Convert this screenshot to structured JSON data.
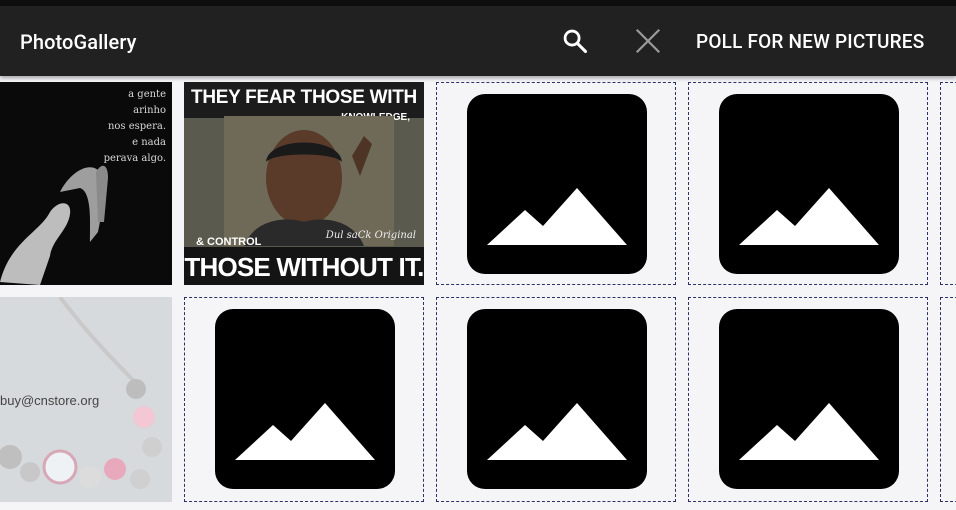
{
  "app": {
    "title": "PhotoGallery",
    "poll_label": "POLL FOR NEW PICTURES",
    "search_icon": "search-icon",
    "close_icon": "close-icon"
  },
  "photos": {
    "poem_lines": [
      "a gente",
      "arinho",
      "nos espera.",
      "e nada",
      "perava algo."
    ],
    "meme_top": "THEY FEAR THOSE WITH",
    "meme_knowledge": "KNOWLEDGE,",
    "meme_control": "& CONTROL",
    "meme_bottom": "THOSE WITHOUT IT.",
    "meme_signature": "Dul saCk Original",
    "store_email": "buy@cnstore.org"
  },
  "colors": {
    "toolbar": "#212121",
    "placeholder_border": "#2d3264",
    "placeholder_icon": "#000000"
  }
}
